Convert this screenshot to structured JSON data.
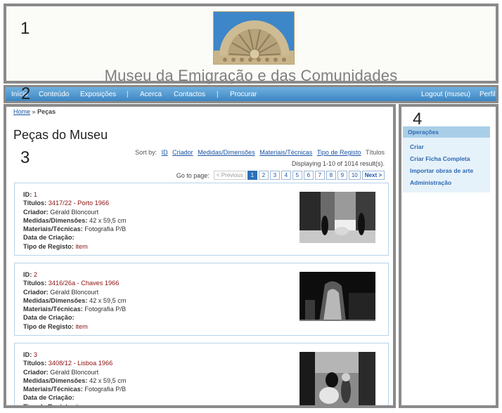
{
  "regions": {
    "header": "1",
    "nav": "2",
    "main": "3",
    "sidebar": "4"
  },
  "site": {
    "title": "Museu da Emigração e das Comunidades"
  },
  "nav": {
    "left": [
      "Início",
      "Conteúdo",
      "Exposições",
      "Acerca",
      "Contactos",
      "Procurar"
    ],
    "separator": "|",
    "logout": "Logout (museu)",
    "profile": "Perfil"
  },
  "breadcrumb": {
    "home": "Home",
    "sep": "»",
    "current": "Peças"
  },
  "page_title": "Peças do Museu",
  "sort": {
    "label": "Sort by:",
    "links": [
      "ID",
      "Criador",
      "Medidas/Dimensões",
      "Materiais/Técnicas",
      "Tipo de Registo"
    ],
    "current": "Títulos"
  },
  "summary": "Displaying 1-10 of 1014 result(s).",
  "pager": {
    "label": "Go to page:",
    "prev": "< Previous",
    "pages": [
      "1",
      "2",
      "3",
      "4",
      "5",
      "6",
      "7",
      "8",
      "9",
      "10"
    ],
    "next": "Next >",
    "active": "1"
  },
  "field_labels": {
    "id": "ID:",
    "titulos": "Títulos:",
    "criador": "Criador:",
    "medidas": "Medidas/Dimensões:",
    "materiais": "Materiais/Técnicas:",
    "data": "Data de Criação:",
    "tipo": "Tipo de Registo:"
  },
  "items": [
    {
      "id": "1",
      "titulos": "3417/22 - Porto 1966",
      "criador": "Gérald Bloncourt",
      "medidas": "42 x 59,5 cm",
      "materiais": "Fotografia P/B",
      "data": "",
      "tipo": "item"
    },
    {
      "id": "2",
      "titulos": "3416/26a - Chaves 1966",
      "criador": "Gérald Bloncourt",
      "medidas": "42 x 59,5 cm",
      "materiais": "Fotografia P/B",
      "data": "",
      "tipo": "item"
    },
    {
      "id": "3",
      "titulos": "3408/12 - Lisboa 1966",
      "criador": "Gérald Bloncourt",
      "medidas": "42 x 59,5 cm",
      "materiais": "Fotografia P/B",
      "data": "",
      "tipo": "item"
    }
  ],
  "sidebar": {
    "header": "Operações",
    "ops": [
      "Criar",
      "Criar Ficha Completa",
      "Importar obras de arte",
      "Administração"
    ]
  },
  "colors": {
    "nav_top": "#6fb0de",
    "nav_bottom": "#3d86c4",
    "link": "#1b53a3",
    "value_link": "#8b1111",
    "ops_header": "#a9cfe8",
    "ops_bg": "#e6f2fa"
  }
}
